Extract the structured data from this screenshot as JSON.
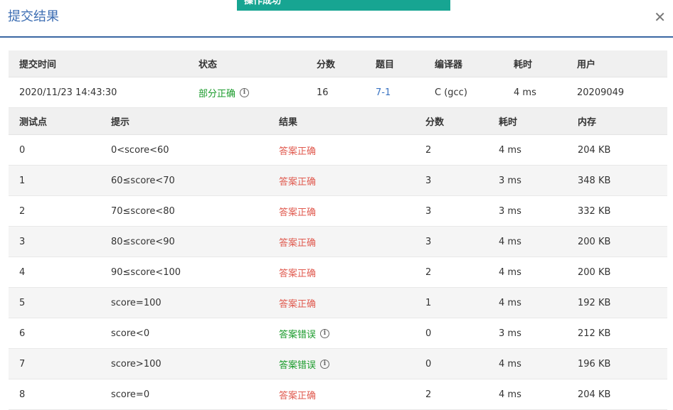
{
  "modal": {
    "title": "提交结果",
    "close_symbol": "✕",
    "toast": "操作成功"
  },
  "summary": {
    "headers": [
      "提交时间",
      "状态",
      "分数",
      "题目",
      "编译器",
      "耗时",
      "用户"
    ],
    "values": {
      "time": "2020/11/23 14:43:30",
      "status": "部分正确",
      "score": "16",
      "problem": "7-1",
      "compiler": "C (gcc)",
      "elapsed": "4 ms",
      "user": "20209049"
    }
  },
  "cases": {
    "headers": [
      "测试点",
      "提示",
      "结果",
      "分数",
      "耗时",
      "内存"
    ],
    "rows": [
      {
        "id": "0",
        "hint": "0<score<60",
        "result": "答案正确",
        "result_type": "ok",
        "score": "2",
        "time": "4 ms",
        "memory": "204 KB"
      },
      {
        "id": "1",
        "hint": "60≤score<70",
        "result": "答案正确",
        "result_type": "ok",
        "score": "3",
        "time": "3 ms",
        "memory": "348 KB"
      },
      {
        "id": "2",
        "hint": "70≤score<80",
        "result": "答案正确",
        "result_type": "ok",
        "score": "3",
        "time": "3 ms",
        "memory": "332 KB"
      },
      {
        "id": "3",
        "hint": "80≤score<90",
        "result": "答案正确",
        "result_type": "ok",
        "score": "3",
        "time": "4 ms",
        "memory": "200 KB"
      },
      {
        "id": "4",
        "hint": "90≤score<100",
        "result": "答案正确",
        "result_type": "ok",
        "score": "2",
        "time": "4 ms",
        "memory": "200 KB"
      },
      {
        "id": "5",
        "hint": "score=100",
        "result": "答案正确",
        "result_type": "ok",
        "score": "1",
        "time": "4 ms",
        "memory": "192 KB"
      },
      {
        "id": "6",
        "hint": "score<0",
        "result": "答案错误",
        "result_type": "wrong",
        "score": "0",
        "time": "3 ms",
        "memory": "212 KB"
      },
      {
        "id": "7",
        "hint": "score>100",
        "result": "答案错误",
        "result_type": "wrong",
        "score": "0",
        "time": "4 ms",
        "memory": "196 KB"
      },
      {
        "id": "8",
        "hint": "score=0",
        "result": "答案正确",
        "result_type": "ok",
        "score": "2",
        "time": "4 ms",
        "memory": "204 KB"
      }
    ]
  },
  "icons": {
    "info": "info-icon",
    "close": "close-icon"
  },
  "colors": {
    "title_blue": "#3d6eb3",
    "correct_red": "#e05a4f",
    "wrong_green": "#1a9b2b",
    "toast_teal": "#17a592"
  }
}
